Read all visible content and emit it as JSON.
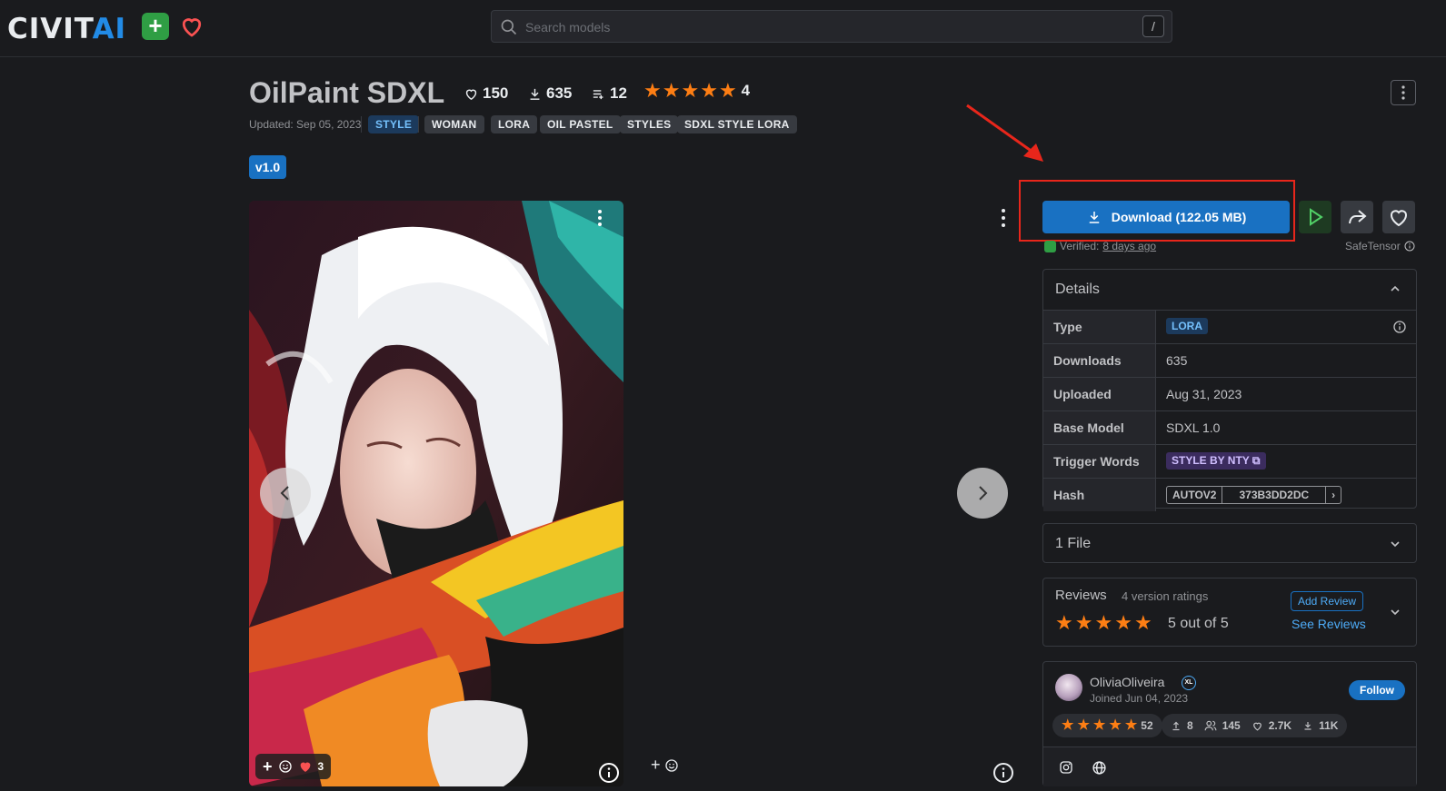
{
  "header": {
    "logo_main": "CIVIT",
    "logo_accent": "AI",
    "search_placeholder": "Search models",
    "search_shortcut": "/"
  },
  "model": {
    "title": "OilPaint SDXL",
    "likes": "150",
    "downloads": "635",
    "collections": "12",
    "rating_count": "4",
    "updated": "Updated: Sep 05, 2023",
    "tags": [
      "STYLE",
      "WOMAN",
      "LORA",
      "OIL PASTEL",
      "STYLES",
      "SDXL STYLE LORA"
    ],
    "version": "v1.0"
  },
  "gallery": {
    "reaction_count": "3",
    "add_reaction": "+"
  },
  "download": {
    "label": "Download (122.05 MB)",
    "verified_label": "Verified:",
    "verified_when": "8 days ago",
    "safetensor": "SafeTensor"
  },
  "details": {
    "heading": "Details",
    "rows": [
      {
        "key": "Type",
        "value": "LORA"
      },
      {
        "key": "Downloads",
        "value": "635"
      },
      {
        "key": "Uploaded",
        "value": "Aug 31, 2023"
      },
      {
        "key": "Base Model",
        "value": "SDXL 1.0"
      },
      {
        "key": "Trigger Words",
        "value": "STYLE BY NTY"
      },
      {
        "key": "Hash",
        "value": "373B3DD2DC"
      }
    ],
    "hash_type": "AUTOV2"
  },
  "files": {
    "label": "1 File"
  },
  "reviews": {
    "heading": "Reviews",
    "ratings_label": "4 version ratings",
    "score_label": "5 out of 5",
    "add_review": "Add Review",
    "see_reviews": "See Reviews",
    "rating": 5
  },
  "creator": {
    "name": "OliviaOliveira",
    "badge": "XL",
    "joined": "Joined Jun 04, 2023",
    "follow": "Follow",
    "rating_count": "52",
    "uploads": "8",
    "followers": "145",
    "likes": "2.7K",
    "downloads": "11K"
  },
  "colors": {
    "accent": "#1971c2",
    "star": "#fd7e14",
    "annotation": "#e8261b",
    "plus_green": "#2f9e44",
    "heart": "#fa5252"
  }
}
